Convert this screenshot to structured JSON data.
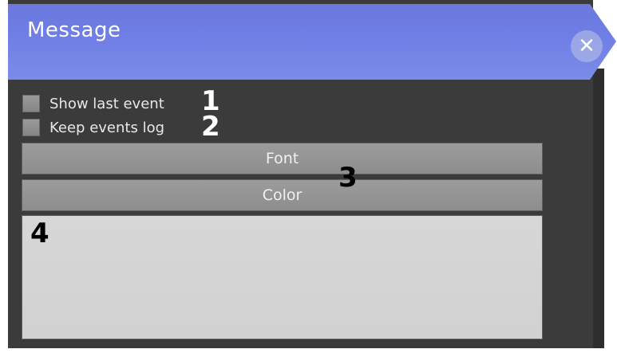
{
  "window": {
    "title": "Message",
    "close_icon": "close-icon",
    "header_color": "#6f7fe6"
  },
  "options": [
    {
      "label": "Show last event",
      "checked": false,
      "callout": "1"
    },
    {
      "label": "Keep events log",
      "checked": false,
      "callout": "2"
    }
  ],
  "buttons": {
    "font_label": "Font",
    "color_label": "Color",
    "callout": "3"
  },
  "message_area": {
    "value": "",
    "callout": "4"
  }
}
